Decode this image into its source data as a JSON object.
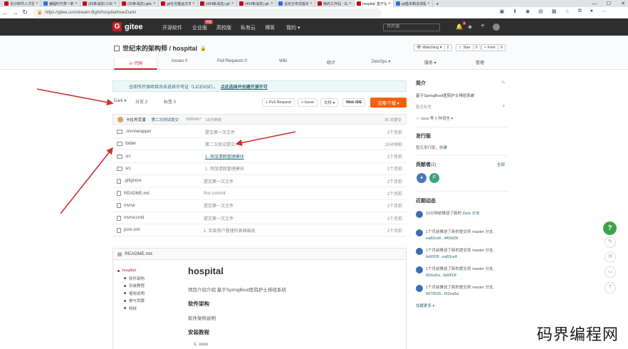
{
  "browser": {
    "tabs": [
      {
        "title": "长沙软件入才招聘",
        "icon": "red"
      },
      {
        "title": "编程时代梦 / 架构师",
        "icon": "blue"
      },
      {
        "title": "(30条消息) CSD",
        "icon": "red"
      },
      {
        "title": "(30条消息) gitee",
        "icon": "red"
      },
      {
        "title": "git仓交搬运文件",
        "icon": "red"
      },
      {
        "title": "(404条消息) git...",
        "icon": "red"
      },
      {
        "title": "(404条消息) git...",
        "icon": "red"
      },
      {
        "title": "设定分布式版本控",
        "icon": "blue"
      },
      {
        "title": "我的工作站 - Gitee",
        "icon": "red"
      },
      {
        "title": "hospital: 基于Spri",
        "icon": "red",
        "active": true
      },
      {
        "title": "git基本制造流程",
        "icon": "blue"
      }
    ],
    "url": "https://gitee.com/dream-flight/hospital/tree/Dark/",
    "new_tab": "+"
  },
  "header": {
    "logo_letter": "G",
    "logo_text": "gitee",
    "nav": [
      "开源软件",
      "企业版",
      "高校版",
      "私有云",
      "博客",
      "我的 ▾"
    ],
    "hot_badge": "特惠",
    "search_placeholder": "开开源",
    "notif_count": "2",
    "plus": "+"
  },
  "repo": {
    "owner_name": "世纪末的架构师 / hospital",
    "watching_label": "👁 Watching ▾",
    "watching_count": "2",
    "star_label": "☆ Star",
    "star_count": "0",
    "fork_label": "⑂ Fork",
    "fork_count": "0",
    "tabs": [
      "‹/› 代码",
      "Issues 0",
      "Pull Requests 0",
      "Wiki",
      "统计",
      "DevOps ▾",
      "服务 ▾",
      "管理"
    ]
  },
  "notice": {
    "text": "仓库所开源项目尚未选择许可证（LICENSE）。",
    "link": "点此选择并创建开源许可"
  },
  "toolbar": {
    "branch": "Dark ▾",
    "branches": "分支 2",
    "tags": "标签 0",
    "pull_request": "+ Pull Request",
    "issue": "+ Issue",
    "file": "文件 ▾",
    "webide": "Web IDE",
    "clone": "克隆/下载 ▾"
  },
  "commit": {
    "author": "卡拉肖克潘",
    "message": "第二次测试提交",
    "hash": "3365457",
    "time": "15分钟前",
    "count": "35 次提交"
  },
  "files": [
    {
      "name": ".mvn/wrapper",
      "msg": "提交第一次文件",
      "time": "1个月前",
      "type": "folder",
      "link": false
    },
    {
      "name": "folder",
      "msg": "第二次测试提交",
      "time": "15分钟前",
      "type": "folder",
      "link": false
    },
    {
      "name": "src",
      "msg": "1. 添加请假管理模块",
      "time": "1个月前",
      "type": "folder",
      "link": true
    },
    {
      "name": "src",
      "msg": "1. 添加请假管理模块",
      "time": "1个月前",
      "type": "folder",
      "link": false
    },
    {
      "name": ".gitignore",
      "msg": "提交第一次文件",
      "time": "1个月前",
      "type": "file",
      "link": false
    },
    {
      "name": "README.md",
      "msg": "first commit",
      "time": "1个月前",
      "type": "file",
      "link": false
    },
    {
      "name": "mvnw",
      "msg": "提交第一次文件",
      "time": "1个月前",
      "type": "file",
      "link": false
    },
    {
      "name": "mvnw.cmd",
      "msg": "提交第一次文件",
      "time": "1个月前",
      "type": "file",
      "link": false
    },
    {
      "name": "pom.xml",
      "msg": "1. 实现用户管理的表格展现",
      "time": "1个月前",
      "type": "file",
      "link": false
    }
  ],
  "readme": {
    "filename": "README.md",
    "toc": [
      "hospital",
      "软件架构",
      "安装教程",
      "使用说明",
      "参与贡献",
      "特技"
    ],
    "title": "hospital",
    "intro": "项目介绍介绍 基于SpringBoot医院护士排班系统",
    "h_arch": "软件架构",
    "arch_text": "软件架构说明",
    "h_install": "安装教程",
    "install_item": "1. xxxx"
  },
  "sidebar": {
    "intro_h": "简介",
    "intro_text": "基于SpringBoot医院护士排班系统",
    "no_tags": "暂无标签",
    "lang": "Java 等 5 种语言 ▾",
    "release_h": "发行版",
    "release_text": "暂无发行版，",
    "release_link": "创建",
    "contrib_h": "贡献者",
    "contrib_count": "(2)",
    "contrib_all": "全部",
    "contrib_letter": "F",
    "activity_h": "近期动态",
    "activities": [
      {
        "text": "10分钟前推送了新的 ",
        "link": "Dark 分支"
      },
      {
        "text": "1个月前推送了新的提交到 master 分支, ",
        "link": "ea83ce8...4f00d28"
      },
      {
        "text": "1个月前推送了新的提交到 master 分支, ",
        "link": "fa6003f...ea83ce8"
      },
      {
        "text": "1个月前推送了新的提交到 master 分支, ",
        "link": "6f2ea5a...fa6003f"
      },
      {
        "text": "1个月前推送了新的提交到 master 分支, ",
        "link": "5679535...6f2ea5a"
      }
    ],
    "more": "加载更多 ▾"
  },
  "watermark": "码界编程网",
  "colors": {
    "brand": "#c71d23",
    "clone": "#f7600b",
    "header": "#2e2e2e",
    "help": "#3ba54e",
    "arrow": "#d32f2f"
  }
}
